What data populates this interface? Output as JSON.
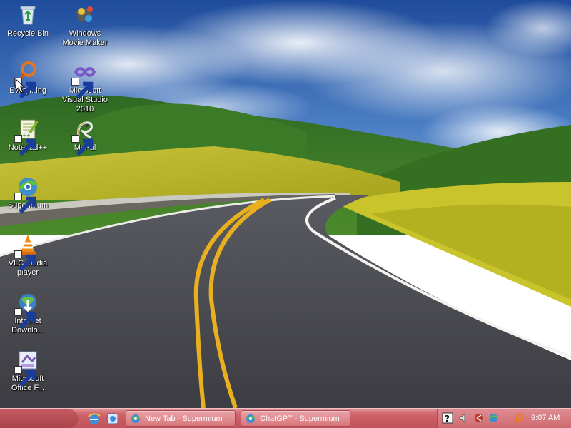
{
  "desktop": {
    "icons": [
      {
        "label": "Recycle Bin",
        "icon": "recycle-bin-icon",
        "shortcut": false
      },
      {
        "label": "Windows Movie Maker",
        "icon": "movie-maker-icon",
        "shortcut": false
      },
      {
        "label": "Everything",
        "icon": "everything-search-icon",
        "shortcut": true
      },
      {
        "label": "Microsoft Visual Studio 2010",
        "icon": "visual-studio-icon",
        "shortcut": true
      },
      {
        "label": "Notepad++",
        "icon": "notepad-plus-plus-icon",
        "shortcut": true
      },
      {
        "label": "MyPal",
        "icon": "mypal-icon",
        "shortcut": true
      },
      {
        "label": "Supermium",
        "icon": "supermium-icon",
        "shortcut": true
      },
      {
        "label": "VLC media player",
        "icon": "vlc-icon",
        "shortcut": true
      },
      {
        "label": "Internet Downlo...",
        "icon": "internet-download-manager-icon",
        "shortcut": true
      },
      {
        "label": "Microsoft Office F...",
        "icon": "office-icon",
        "shortcut": true
      }
    ]
  },
  "taskbar": {
    "quick_launch": [
      "internet-explorer-icon",
      "show-desktop-icon"
    ],
    "tasks": [
      {
        "label": "New Tab - Supermium",
        "icon": "supermium-icon"
      },
      {
        "label": "ChatGPT - Supermium",
        "icon": "supermium-icon"
      }
    ],
    "tray_icons": [
      "help-icon",
      "volume-icon",
      "network-icon",
      "everything-search-icon"
    ],
    "clock": "9:07 AM"
  },
  "colors": {
    "taskbar": "#c95b62",
    "sky": "#2a5aa8",
    "grass": "#3f7a2a",
    "road": "#4a4a50",
    "road_line": "#e8b01e"
  }
}
